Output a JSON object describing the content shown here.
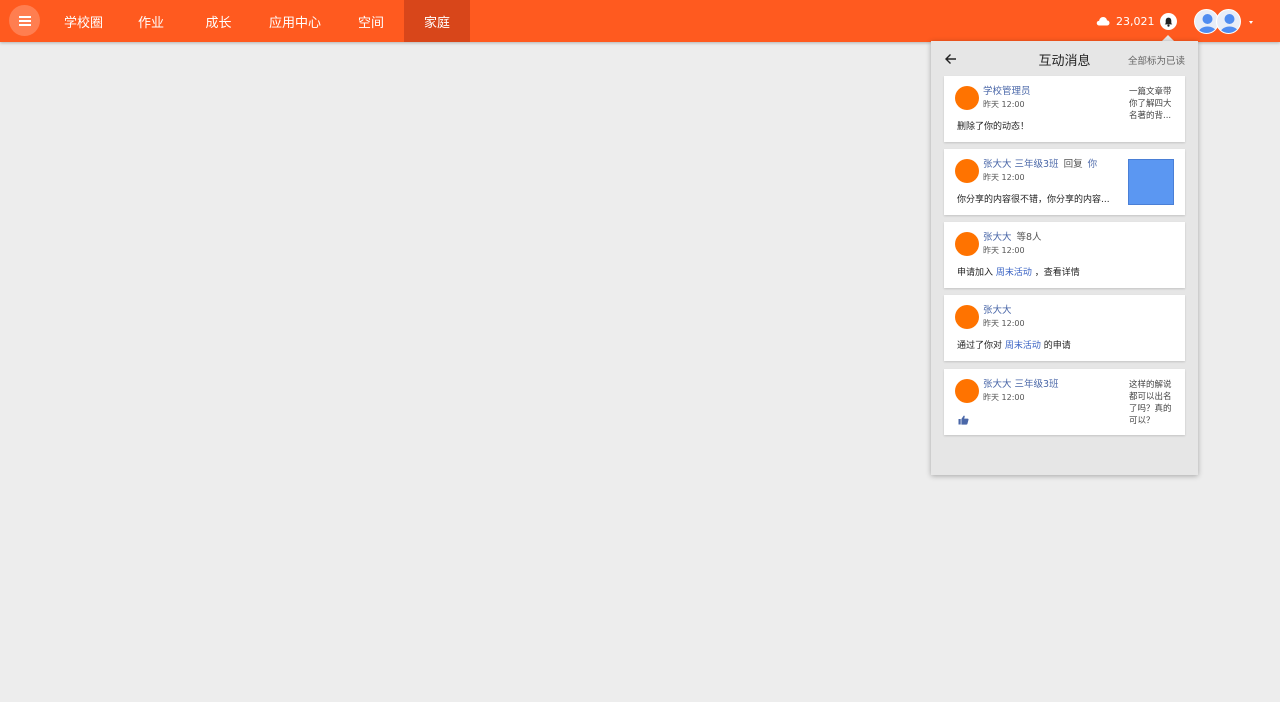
{
  "topbar": {
    "nav": [
      {
        "label": "学校圈",
        "active": false
      },
      {
        "label": "作业",
        "active": false
      },
      {
        "label": "成长",
        "active": false
      },
      {
        "label": "应用中心",
        "active": false
      },
      {
        "label": "空间",
        "active": false
      },
      {
        "label": "家庭",
        "active": true
      }
    ],
    "cloud_count": "23,021",
    "icons": {
      "menu": "menu-icon",
      "cloud": "cloud-icon",
      "bell": "bell-icon",
      "avatar": "user-avatar-icon",
      "caret": "caret-down-icon"
    }
  },
  "colors": {
    "brand": "#ff5a1f",
    "brand_active": "#d8461a",
    "avatar": "#ff7300",
    "link": "#4a67a8",
    "thumb": "#5b97f2"
  },
  "panel": {
    "title": "互动消息",
    "mark_all_read": "全部标为已读",
    "notifications": [
      {
        "name": "学校管理员",
        "class": "",
        "extra": "",
        "extra_link": "",
        "time": "昨天 12:00",
        "body_pre": "删除了你的动态！",
        "body_link": "",
        "body_post": "",
        "quote": "一篇文章带你了解四大名著的背...",
        "has_thumb": false,
        "liked": false
      },
      {
        "name": "张大大",
        "class": "三年级3班",
        "extra": "回复",
        "extra_link": "你",
        "time": "昨天 12:00",
        "body_pre": "你分享的内容很不错，你分享的内容...",
        "body_link": "",
        "body_post": "",
        "quote": "",
        "has_thumb": true,
        "liked": false
      },
      {
        "name": "张大大",
        "class": "",
        "extra": "等8人",
        "extra_link": "",
        "time": "昨天 12:00",
        "body_pre": "申请加入 ",
        "body_link": "周末活动",
        "body_post": " ，查看详情",
        "quote": "",
        "has_thumb": false,
        "liked": false
      },
      {
        "name": "张大大",
        "class": "",
        "extra": "",
        "extra_link": "",
        "time": "昨天 12:00",
        "body_pre": "通过了你对 ",
        "body_link": "周末活动",
        "body_post": " 的申请",
        "quote": "",
        "has_thumb": false,
        "liked": false
      },
      {
        "name": "张大大",
        "class": "三年级3班",
        "extra": "",
        "extra_link": "",
        "time": "昨天 12:00",
        "body_pre": "",
        "body_link": "",
        "body_post": "",
        "quote": "这样的解说都可以出名了吗？真的可以？",
        "has_thumb": false,
        "liked": true
      }
    ]
  }
}
